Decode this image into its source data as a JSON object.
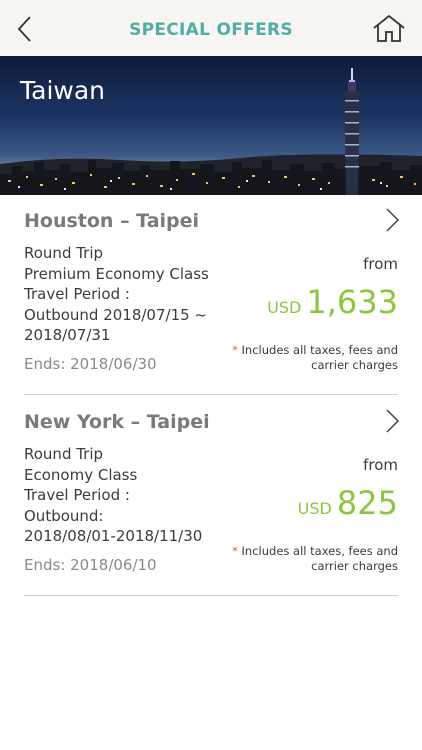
{
  "header": {
    "title": "SPECIAL OFFERS",
    "back_icon": "chevron-left-icon",
    "home_icon": "house-icon"
  },
  "hero": {
    "title": "Taiwan"
  },
  "offers": [
    {
      "route": "Houston – Taipei",
      "details": [
        "Round Trip",
        "Premium Economy Class",
        "Travel Period :",
        "Outbound 2018/07/15 ~",
        "2018/07/31"
      ],
      "ends": "Ends: 2018/06/30",
      "from_label": "from",
      "currency": "USD",
      "amount": "1,633",
      "note_star": "*",
      "note": " Includes all taxes, fees and carrier charges"
    },
    {
      "route": "New York – Taipei",
      "details": [
        "Round Trip",
        "Economy Class",
        "Travel Period :",
        "Outbound:",
        "2018/08/01-2018/11/30"
      ],
      "ends": "Ends: 2018/06/10",
      "from_label": "from",
      "currency": "USD",
      "amount": "825",
      "note_star": "*",
      "note": " Includes all taxes, fees and carrier charges"
    }
  ],
  "colors": {
    "accent_teal": "#52aea4",
    "price_green": "#8cc63e",
    "note_star": "#e35a2a"
  }
}
